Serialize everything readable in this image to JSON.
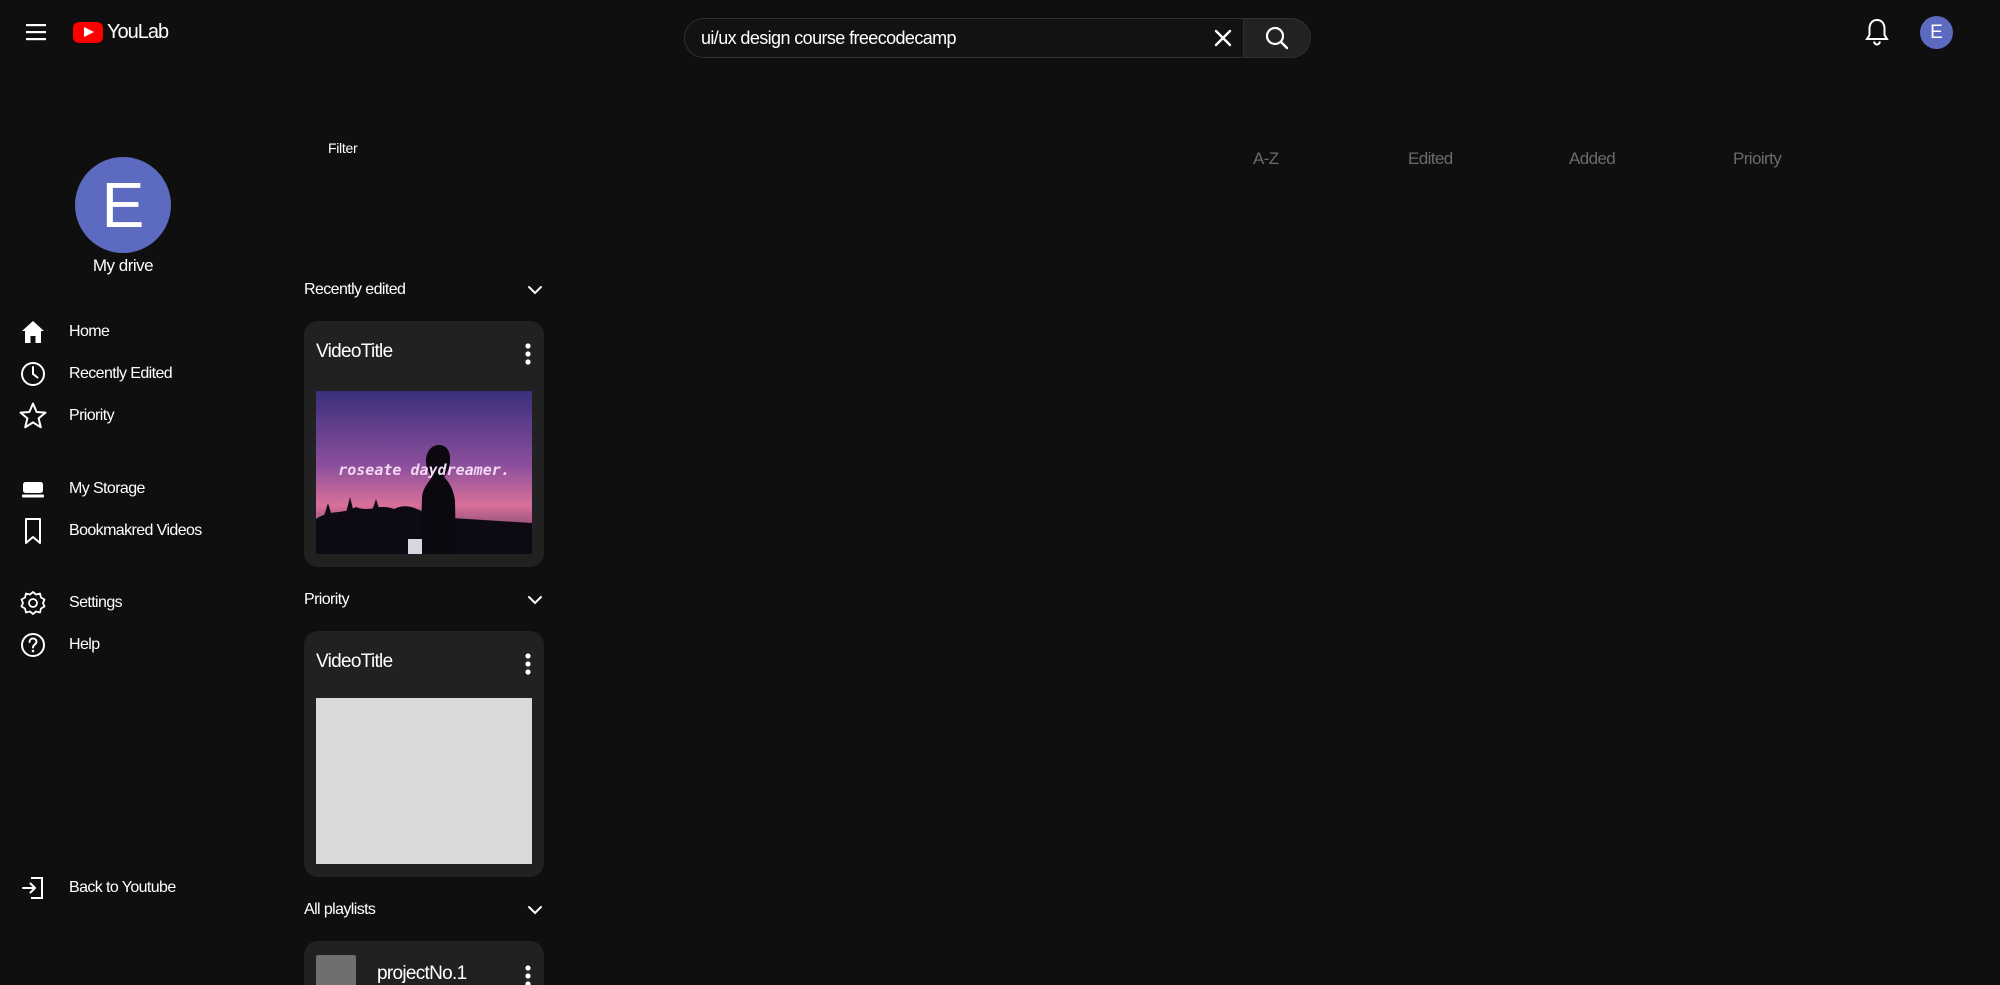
{
  "app": {
    "name": "YouLab"
  },
  "search": {
    "value": "ui/ux design course freecodecamp"
  },
  "user": {
    "initial": "E"
  },
  "sidebar": {
    "drive_initial": "E",
    "drive_label": "My drive",
    "items": [
      {
        "label": "Home",
        "icon": "home-icon"
      },
      {
        "label": "Recently Edited",
        "icon": "clock-icon"
      },
      {
        "label": "Priority",
        "icon": "star-icon"
      },
      {
        "label": "My Storage",
        "icon": "storage-icon"
      },
      {
        "label": "Bookmakred Videos",
        "icon": "bookmark-icon"
      },
      {
        "label": "Settings",
        "icon": "gear-icon"
      },
      {
        "label": "Help",
        "icon": "help-icon"
      }
    ],
    "back": {
      "label": "Back to Youtube",
      "icon": "exit-icon"
    }
  },
  "main": {
    "filter_label": "Filter",
    "sort_options": [
      "A-Z",
      "Edited",
      "Added",
      "Prioirty"
    ],
    "sections": {
      "recent": {
        "title": "Recently edited",
        "card_title": "VideoTitle",
        "thumb_text": "roseate daydreamer."
      },
      "priority": {
        "title": "Priority",
        "card_title": "VideoTitle"
      },
      "playlists": {
        "title": "All playlists",
        "item_title": "projectNo.1"
      }
    }
  },
  "colors": {
    "background": "#0f0f0f",
    "card": "#212121",
    "avatar": "#5c6bc0",
    "brand": "#ff0000",
    "muted_text": "#6b6b6b"
  }
}
